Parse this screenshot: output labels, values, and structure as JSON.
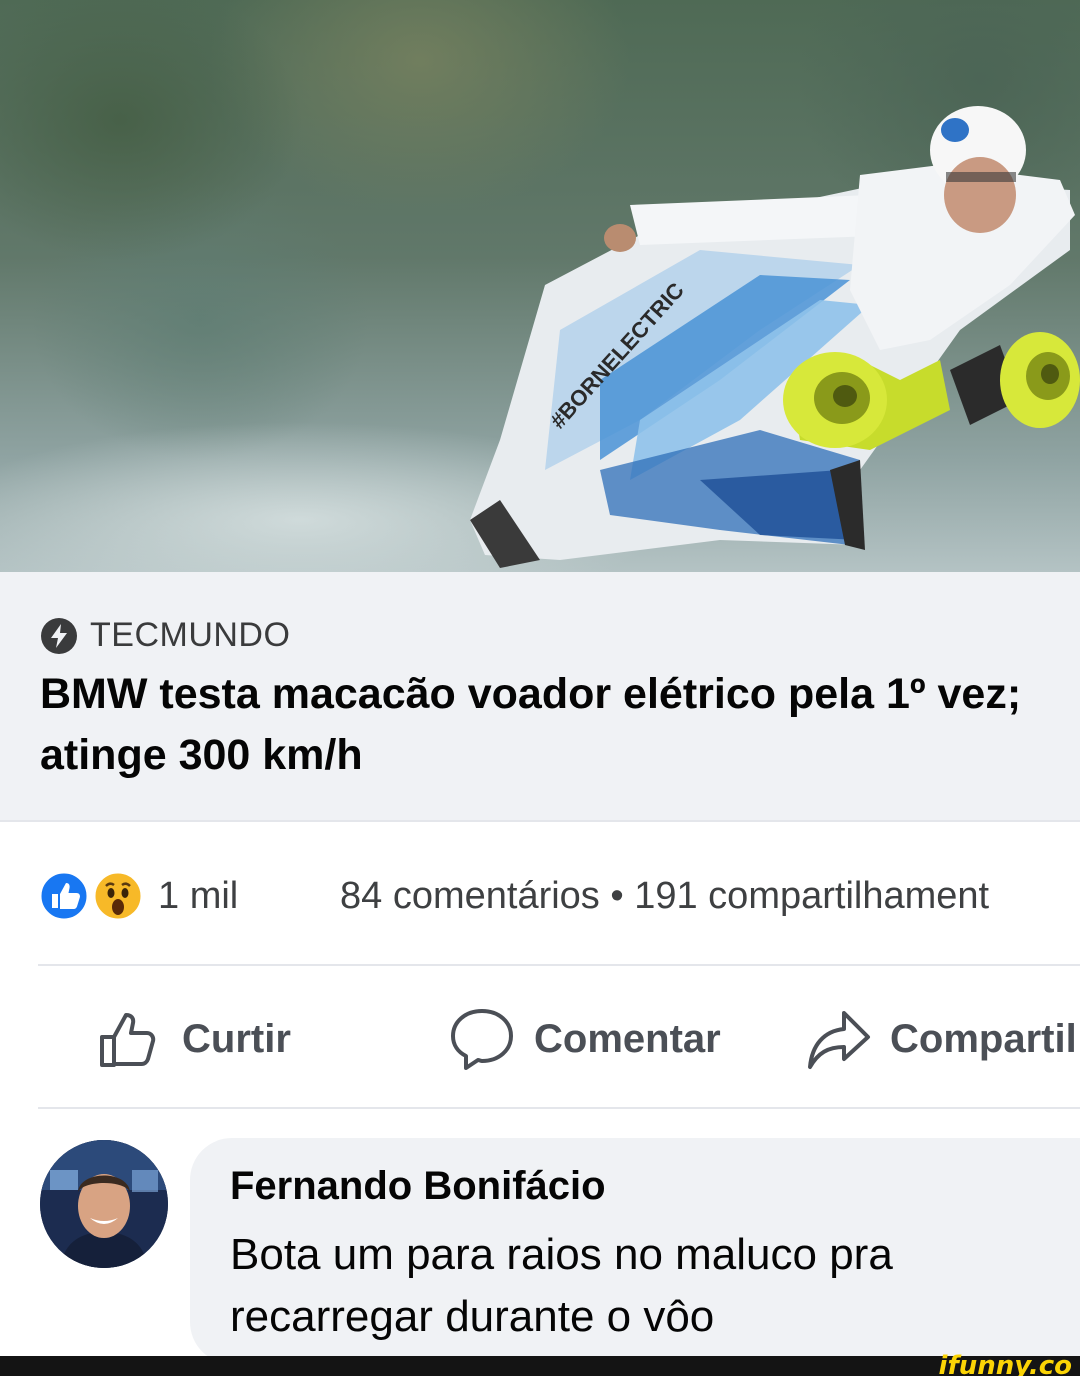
{
  "link_preview": {
    "source": "TECMUNDO",
    "headline": "BMW testa macacão voador elétrico pela 1º vez; atinge 300 km/h"
  },
  "stats": {
    "reaction_count": "1 mil",
    "comments_shares": "84 comentários • 191 compartilhament"
  },
  "actions": {
    "like": "Curtir",
    "comment": "Comentar",
    "share": "Compartil"
  },
  "comment": {
    "author": "Fernando Bonifácio",
    "text": "Bota um para raios no maluco pra recarregar durante o vôo"
  },
  "watermark": "ifunny.co",
  "colors": {
    "like_blue": "#1877f2",
    "wow_yellow": "#f7b928",
    "link_bg": "#f0f2f5",
    "watermark_yellow": "#fbd405"
  },
  "icons": [
    "bolt-icon",
    "like-reaction-icon",
    "wow-reaction-icon",
    "thumb-up-icon",
    "speech-bubble-icon",
    "share-arrow-icon"
  ]
}
